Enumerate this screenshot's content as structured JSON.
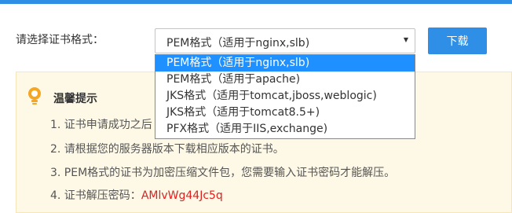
{
  "form": {
    "label": "请选择证书格式：",
    "selected_value": "PEM格式（适用于nginx,slb)",
    "options": [
      "PEM格式（适用于nginx,slb)",
      "PEM格式（适用于apache)",
      "JKS格式（适用于tomcat,jboss,weblogic)",
      "JKS格式（适用于tomcat8.5+)",
      "PFX格式（适用于IIS,exchange)"
    ],
    "download_label": "下载"
  },
  "tips": {
    "title": "温馨提示",
    "line1": "1. 证书申请成功之后",
    "line2": "2. 请根据您的服务器版本下载相应版本的证书。",
    "line3": "3. PEM格式的证书为加密压缩文件包，您需要输入证书密码才能解压。",
    "line4_label": "4. 证书解压密码：",
    "line4_value": "AMlvWg44Jc5q"
  },
  "colors": {
    "accent": "#2f8fe6",
    "highlight": "#1e90ff",
    "tips_background": "#fef9e7",
    "password": "#e02020"
  },
  "icons": {
    "tips": "lightbulb-icon",
    "dropdown": "caret-down-icon"
  }
}
